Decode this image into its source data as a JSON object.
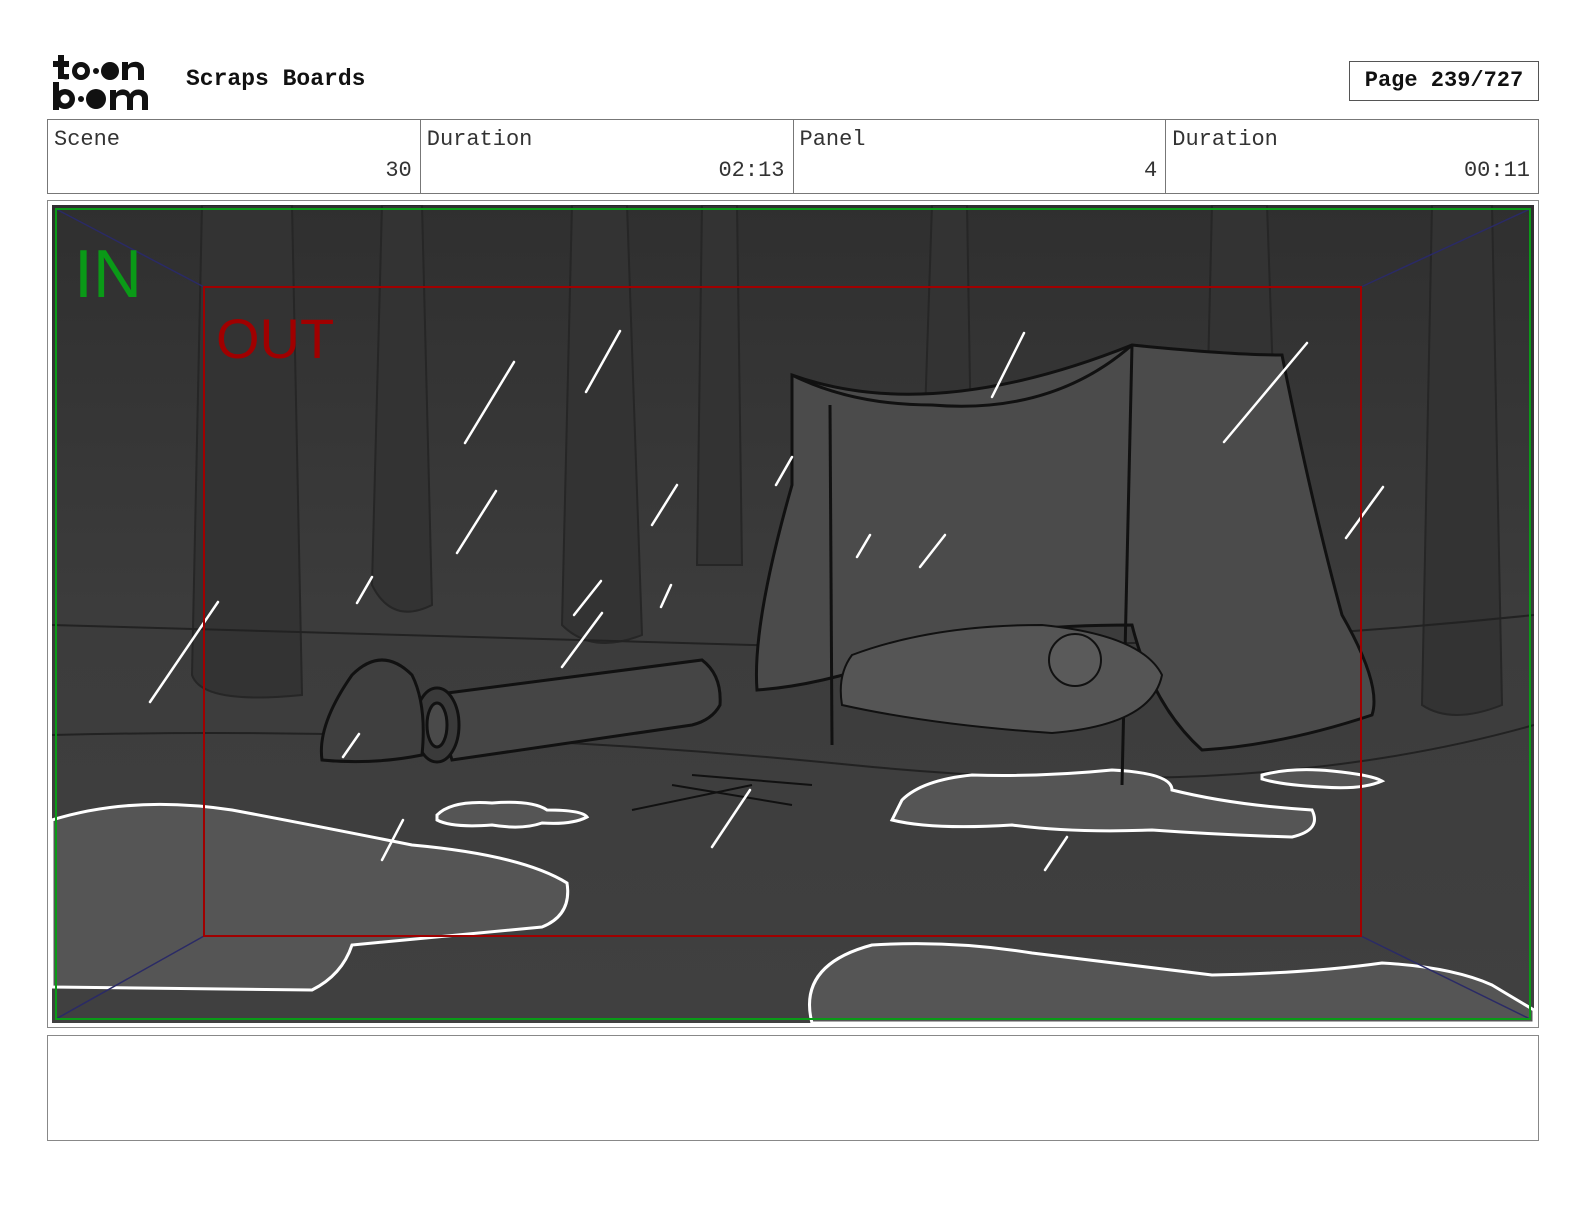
{
  "header": {
    "logo_text": "toon boom",
    "title": "Scraps Boards",
    "page_label": "Page 239/727"
  },
  "info": [
    {
      "label": "Scene",
      "value": "30"
    },
    {
      "label": "Duration",
      "value": "02:13"
    },
    {
      "label": "Panel",
      "value": "4"
    },
    {
      "label": "Duration",
      "value": "00:11"
    }
  ],
  "panel": {
    "in_label": "IN",
    "out_label": "OUT",
    "colors": {
      "background": "#3a3a3a",
      "in_frame": "#0a9a17",
      "out_frame": "#a00000",
      "rain": "#ffffff",
      "puddle_outline": "#ffffff"
    }
  },
  "notes": {
    "text": ""
  }
}
